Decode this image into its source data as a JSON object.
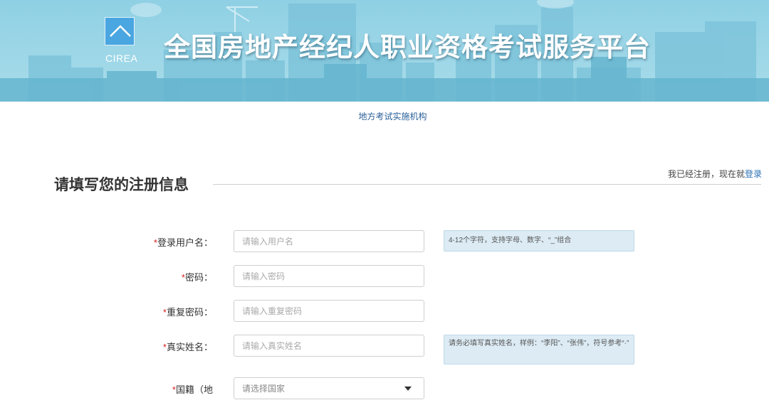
{
  "header": {
    "logo_text": "CIREA",
    "title": "全国房地产经纪人职业资格考试服务平台"
  },
  "nav": {
    "link": "地方考试实施机构"
  },
  "form": {
    "title": "请填写您的注册信息",
    "login_prompt": "我已经注册，现在就",
    "login_link": "登录",
    "fields": [
      {
        "required_mark": "*",
        "label": "登录用户名：",
        "placeholder": "请输入用户名",
        "tip": "4-12个字符，支持字母、数字、“_”组合"
      },
      {
        "required_mark": "*",
        "label": "密码：",
        "placeholder": "请输入密码"
      },
      {
        "required_mark": "*",
        "label": "重复密码：",
        "placeholder": "请输入重复密码"
      },
      {
        "required_mark": "*",
        "label": "真实姓名：",
        "placeholder": "请输入真实姓名",
        "tip": "请务必填写真实姓名，样例：“李阳”、“张伟”，符号参考“·”"
      },
      {
        "required_mark": "*",
        "label": "国籍（地",
        "placeholder": "请选择国家"
      }
    ]
  }
}
